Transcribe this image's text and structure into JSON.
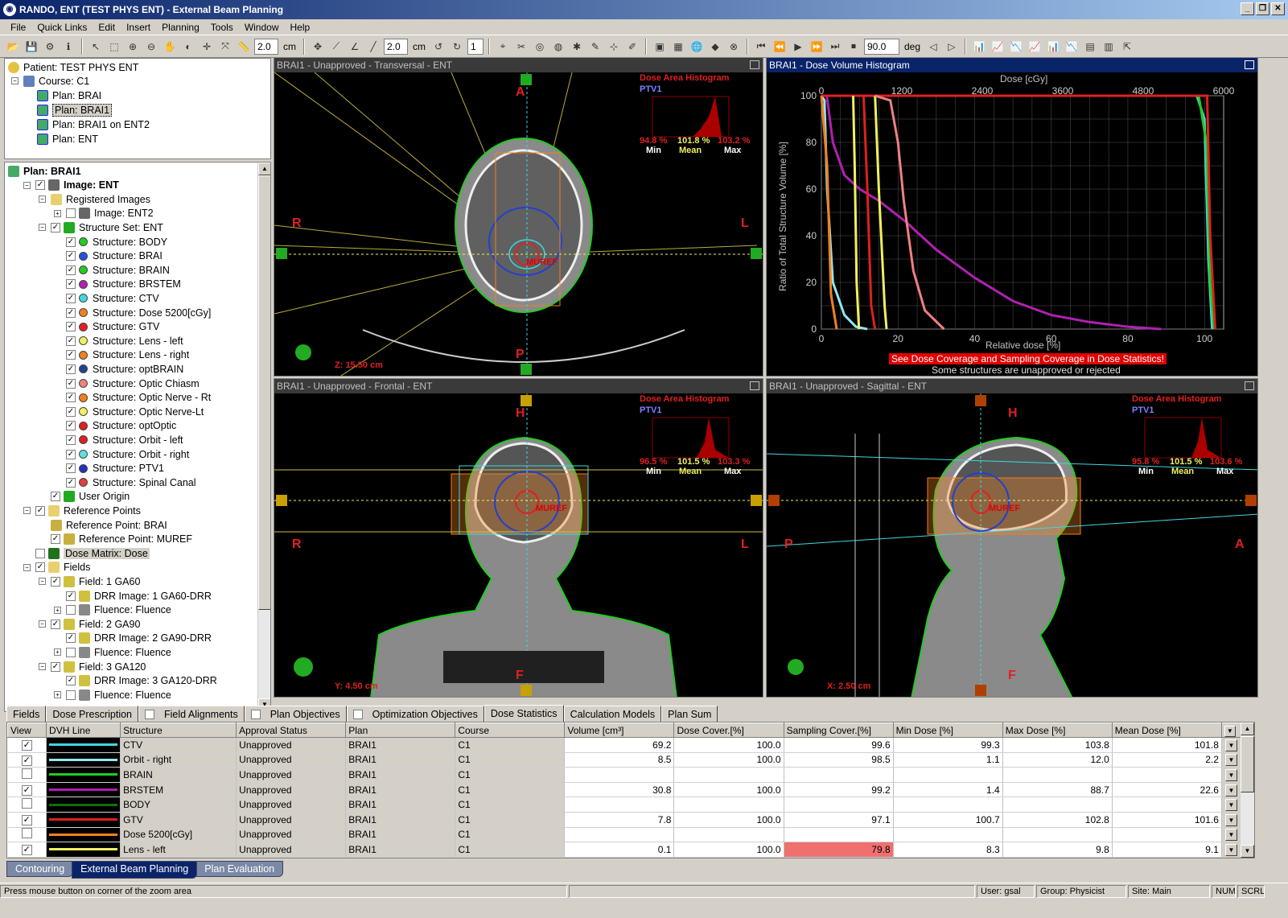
{
  "window": {
    "title": "RANDO, ENT (TEST PHYS ENT) - External Beam Planning"
  },
  "menu": [
    "File",
    "Quick Links",
    "Edit",
    "Insert",
    "Planning",
    "Tools",
    "Window",
    "Help"
  ],
  "toolbar": {
    "zoom_value": "2.0",
    "zoom_unit": "cm",
    "step_value": "2.0",
    "step_unit": "cm",
    "count_value": "1",
    "angle_value": "90.0",
    "angle_unit": "deg"
  },
  "tree_top": [
    {
      "label": "Patient: TEST PHYS ENT"
    },
    {
      "label": "Course: C1"
    },
    {
      "label": "Plan: BRAI"
    },
    {
      "label": "Plan: BRAI1"
    },
    {
      "label": "Plan: BRAI1 on ENT2"
    },
    {
      "label": "Plan: ENT"
    }
  ],
  "tree_main": [
    {
      "label": "Plan: BRAI1",
      "lvl": 0,
      "color": "#4a6"
    },
    {
      "label": "Image: ENT",
      "lvl": 1,
      "color": "#666"
    },
    {
      "label": "Registered Images",
      "lvl": 2,
      "color": "#e8d070"
    },
    {
      "label": "Image: ENT2",
      "lvl": 3,
      "color": "#666"
    },
    {
      "label": "Structure Set: ENT",
      "lvl": 2,
      "color": "#2a2"
    },
    {
      "label": "Structure: BODY",
      "lvl": 3,
      "color": "#22cc22"
    },
    {
      "label": "Structure: BRAI",
      "lvl": 3,
      "color": "#2255dd"
    },
    {
      "label": "Structure: BRAIN",
      "lvl": 3,
      "color": "#22cc22"
    },
    {
      "label": "Structure: BRSTEM",
      "lvl": 3,
      "color": "#b020b0"
    },
    {
      "label": "Structure: CTV",
      "lvl": 3,
      "color": "#40d8e0"
    },
    {
      "label": "Structure: Dose 5200[cGy]",
      "lvl": 3,
      "color": "#f08020"
    },
    {
      "label": "Structure: GTV",
      "lvl": 3,
      "color": "#e02020"
    },
    {
      "label": "Structure: Lens - left",
      "lvl": 3,
      "color": "#f0f060"
    },
    {
      "label": "Structure: Lens - right",
      "lvl": 3,
      "color": "#f08020"
    },
    {
      "label": "Structure: optBRAIN",
      "lvl": 3,
      "color": "#204090"
    },
    {
      "label": "Structure: Optic Chiasm",
      "lvl": 3,
      "color": "#f08080"
    },
    {
      "label": "Structure: Optic Nerve - Rt",
      "lvl": 3,
      "color": "#f08020"
    },
    {
      "label": "Structure: Optic Nerve-Lt",
      "lvl": 3,
      "color": "#f0f060"
    },
    {
      "label": "Structure: optOptic",
      "lvl": 3,
      "color": "#e02020"
    },
    {
      "label": "Structure: Orbit - left",
      "lvl": 3,
      "color": "#e02020"
    },
    {
      "label": "Structure: Orbit - right",
      "lvl": 3,
      "color": "#60e0e0"
    },
    {
      "label": "Structure: PTV1",
      "lvl": 3,
      "color": "#2030c0"
    },
    {
      "label": "Structure: Spinal Canal",
      "lvl": 3,
      "color": "#e04040"
    },
    {
      "label": "User Origin",
      "lvl": 2,
      "color": "#22aa22"
    },
    {
      "label": "Reference Points",
      "lvl": 1,
      "color": "#e8d070"
    },
    {
      "label": "Reference Point: BRAI",
      "lvl": 2,
      "color": "#c8b040"
    },
    {
      "label": "Reference Point: MUREF",
      "lvl": 2,
      "color": "#c8b040"
    },
    {
      "label": "Dose Matrix: Dose",
      "lvl": 1,
      "color": "#207020"
    },
    {
      "label": "Fields",
      "lvl": 1,
      "color": "#e8d070"
    },
    {
      "label": "Field: 1 GA60",
      "lvl": 2,
      "color": "#d0c040"
    },
    {
      "label": "DRR Image: 1 GA60-DRR",
      "lvl": 3,
      "color": "#d0c040"
    },
    {
      "label": "Fluence: Fluence",
      "lvl": 3,
      "color": "#888"
    },
    {
      "label": "Field: 2 GA90",
      "lvl": 2,
      "color": "#d0c040"
    },
    {
      "label": "DRR Image: 2 GA90-DRR",
      "lvl": 3,
      "color": "#d0c040"
    },
    {
      "label": "Fluence: Fluence",
      "lvl": 3,
      "color": "#888"
    },
    {
      "label": "Field: 3 GA120",
      "lvl": 2,
      "color": "#d0c040"
    },
    {
      "label": "DRR Image: 3 GA120-DRR",
      "lvl": 3,
      "color": "#d0c040"
    },
    {
      "label": "Fluence: Fluence",
      "lvl": 3,
      "color": "#888"
    }
  ],
  "views": {
    "transversal": {
      "title": "BRAI1 - Unapproved - Transversal - ENT",
      "top": "A",
      "bottom": "P",
      "left": "R",
      "right": "L",
      "coord": "Z: 15.50 cm",
      "dah_min": "94.8 %",
      "dah_mean": "101.8 %",
      "dah_max": "103.2 %"
    },
    "frontal": {
      "title": "BRAI1 - Unapproved - Frontal - ENT",
      "top": "H",
      "bottom": "F",
      "left": "R",
      "right": "L",
      "coord": "Y: 4.50 cm",
      "dah_min": "96.5 %",
      "dah_mean": "101.5 %",
      "dah_max": "103.3 %"
    },
    "sagittal": {
      "title": "BRAI1 - Unapproved - Sagittal - ENT",
      "top": "H",
      "bottom": "F",
      "left": "P",
      "right": "A",
      "coord": "X: 2.50 cm",
      "dah_min": "95.8 %",
      "dah_mean": "101.5 %",
      "dah_max": "103.6 %"
    },
    "dah_title": "Dose Area Histogram",
    "dah_struct": "PTV1",
    "dah_min_lbl": "Min",
    "dah_mean_lbl": "Mean",
    "dah_max_lbl": "Max",
    "muref": "MUREF"
  },
  "dvh": {
    "title": "BRAI1 - Dose Volume Histogram",
    "top_axis_label": "Dose [cGy]",
    "top_ticks": [
      "0",
      "1200",
      "2400",
      "3600",
      "4800",
      "6000"
    ],
    "y_label": "Ratio of Total Structure Volume [%]",
    "y_ticks": [
      "100",
      "80",
      "60",
      "40",
      "20",
      "0"
    ],
    "x_label": "Relative dose [%]",
    "x_ticks": [
      "0",
      "20",
      "40",
      "60",
      "80",
      "100"
    ],
    "warning": "See Dose Coverage and Sampling Coverage in Dose Statistics!",
    "note": "Some structures are unapproved or rejected"
  },
  "chart_data": {
    "type": "line",
    "xlabel": "Relative dose [%]",
    "ylabel": "Ratio of Total Structure Volume [%]",
    "xlim": [
      0,
      105
    ],
    "ylim": [
      0,
      100
    ],
    "series": [
      {
        "name": "CTV",
        "color": "#40d8e0",
        "x": [
          0,
          98,
          100,
          101,
          102
        ],
        "y": [
          100,
          100,
          90,
          30,
          0
        ]
      },
      {
        "name": "Orbit - right",
        "color": "#90e8f0",
        "x": [
          0,
          0.8,
          1.5,
          3,
          6,
          9,
          12
        ],
        "y": [
          100,
          98,
          60,
          20,
          6,
          1,
          0
        ]
      },
      {
        "name": "BRAIN",
        "color": "#22cc22",
        "x": [
          0,
          98.5,
          100.5,
          101.5,
          102.5
        ],
        "y": [
          100,
          100,
          80,
          20,
          0
        ]
      },
      {
        "name": "BRSTEM",
        "color": "#b020b0",
        "x": [
          1.4,
          3,
          6,
          10,
          15,
          22,
          30,
          40,
          50,
          60,
          70,
          80,
          88.7
        ],
        "y": [
          100,
          80,
          66,
          60,
          55,
          46,
          34,
          22,
          12,
          6,
          3,
          1,
          0
        ]
      },
      {
        "name": "GTV",
        "color": "#e02020",
        "x": [
          0,
          100.7,
          101.5,
          102.8
        ],
        "y": [
          100,
          100,
          40,
          0
        ]
      },
      {
        "name": "Lens - left",
        "color": "#f0f060",
        "x": [
          8.3,
          8.7,
          9.2,
          9.8
        ],
        "y": [
          100,
          70,
          20,
          0
        ]
      },
      {
        "name": "Lens - right",
        "color": "#f08020",
        "x": [
          0,
          1.5,
          2.5,
          4
        ],
        "y": [
          100,
          70,
          15,
          0
        ]
      },
      {
        "name": "Optic Nerve-Lt",
        "color": "#f0f060",
        "x": [
          14,
          15,
          16.5,
          17
        ],
        "y": [
          100,
          60,
          10,
          0
        ]
      },
      {
        "name": "optOptic",
        "color": "#e02020",
        "x": [
          11,
          12,
          13,
          14
        ],
        "y": [
          100,
          60,
          10,
          0
        ]
      },
      {
        "name": "Optic Chiasm",
        "color": "#f08080",
        "x": [
          14,
          18,
          20,
          21.5,
          24,
          27,
          32
        ],
        "y": [
          100,
          98,
          80,
          55,
          25,
          8,
          0
        ]
      }
    ]
  },
  "bottom_tabs": [
    {
      "label": "Fields",
      "check": false
    },
    {
      "label": "Dose Prescription",
      "check": false
    },
    {
      "label": "Field Alignments",
      "check": true
    },
    {
      "label": "Plan Objectives",
      "check": true
    },
    {
      "label": "Optimization Objectives",
      "check": true
    },
    {
      "label": "Dose Statistics",
      "check": false,
      "active": true
    },
    {
      "label": "Calculation Models",
      "check": false
    },
    {
      "label": "Plan Sum",
      "check": false
    }
  ],
  "table": {
    "headers": [
      "View",
      "DVH Line",
      "Structure",
      "Approval Status",
      "Plan",
      "Course",
      "Volume [cm³]",
      "Dose Cover.[%]",
      "Sampling Cover.[%]",
      "Min Dose [%]",
      "Max Dose [%]",
      "Mean Dose [%]"
    ],
    "rows": [
      {
        "view": true,
        "line": "#40d8e0",
        "structure": "CTV",
        "approval": "Unapproved",
        "plan": "BRAI1",
        "course": "C1",
        "volume": "69.2",
        "dose_cover": "100.0",
        "sampling": "99.6",
        "min": "99.3",
        "max": "103.8",
        "mean": "101.8",
        "warn": false
      },
      {
        "view": true,
        "line": "#90e8f0",
        "structure": "Orbit - right",
        "approval": "Unapproved",
        "plan": "BRAI1",
        "course": "C1",
        "volume": "8.5",
        "dose_cover": "100.0",
        "sampling": "98.5",
        "min": "1.1",
        "max": "12.0",
        "mean": "2.2",
        "warn": false
      },
      {
        "view": false,
        "line": "#22cc22",
        "structure": "BRAIN",
        "approval": "Unapproved",
        "plan": "BRAI1",
        "course": "C1",
        "volume": "",
        "dose_cover": "",
        "sampling": "",
        "min": "",
        "max": "",
        "mean": "",
        "warn": false
      },
      {
        "view": true,
        "line": "#b020b0",
        "structure": "BRSTEM",
        "approval": "Unapproved",
        "plan": "BRAI1",
        "course": "C1",
        "volume": "30.8",
        "dose_cover": "100.0",
        "sampling": "99.2",
        "min": "1.4",
        "max": "88.7",
        "mean": "22.6",
        "warn": false
      },
      {
        "view": false,
        "line": "#107010",
        "structure": "BODY",
        "approval": "Unapproved",
        "plan": "BRAI1",
        "course": "C1",
        "volume": "",
        "dose_cover": "",
        "sampling": "",
        "min": "",
        "max": "",
        "mean": "",
        "warn": false
      },
      {
        "view": true,
        "line": "#e02020",
        "structure": "GTV",
        "approval": "Unapproved",
        "plan": "BRAI1",
        "course": "C1",
        "volume": "7.8",
        "dose_cover": "100.0",
        "sampling": "97.1",
        "min": "100.7",
        "max": "102.8",
        "mean": "101.6",
        "warn": false
      },
      {
        "view": false,
        "line": "#f08020",
        "structure": "Dose 5200[cGy]",
        "approval": "Unapproved",
        "plan": "BRAI1",
        "course": "C1",
        "volume": "",
        "dose_cover": "",
        "sampling": "",
        "min": "",
        "max": "",
        "mean": "",
        "warn": false
      },
      {
        "view": true,
        "line": "#f0f060",
        "structure": "Lens - left",
        "approval": "Unapproved",
        "plan": "BRAI1",
        "course": "C1",
        "volume": "0.1",
        "dose_cover": "100.0",
        "sampling": "79.8",
        "min": "8.3",
        "max": "9.8",
        "mean": "9.1",
        "warn": true
      }
    ]
  },
  "workspace_tabs": [
    {
      "label": "Contouring"
    },
    {
      "label": "External Beam Planning",
      "active": true
    },
    {
      "label": "Plan Evaluation"
    }
  ],
  "status": {
    "message": "Press mouse button on corner of the zoom area",
    "user": "User: gsal",
    "group": "Group: Physicist",
    "site": "Site: Main",
    "num": "NUM",
    "scrl": "SCRL"
  }
}
